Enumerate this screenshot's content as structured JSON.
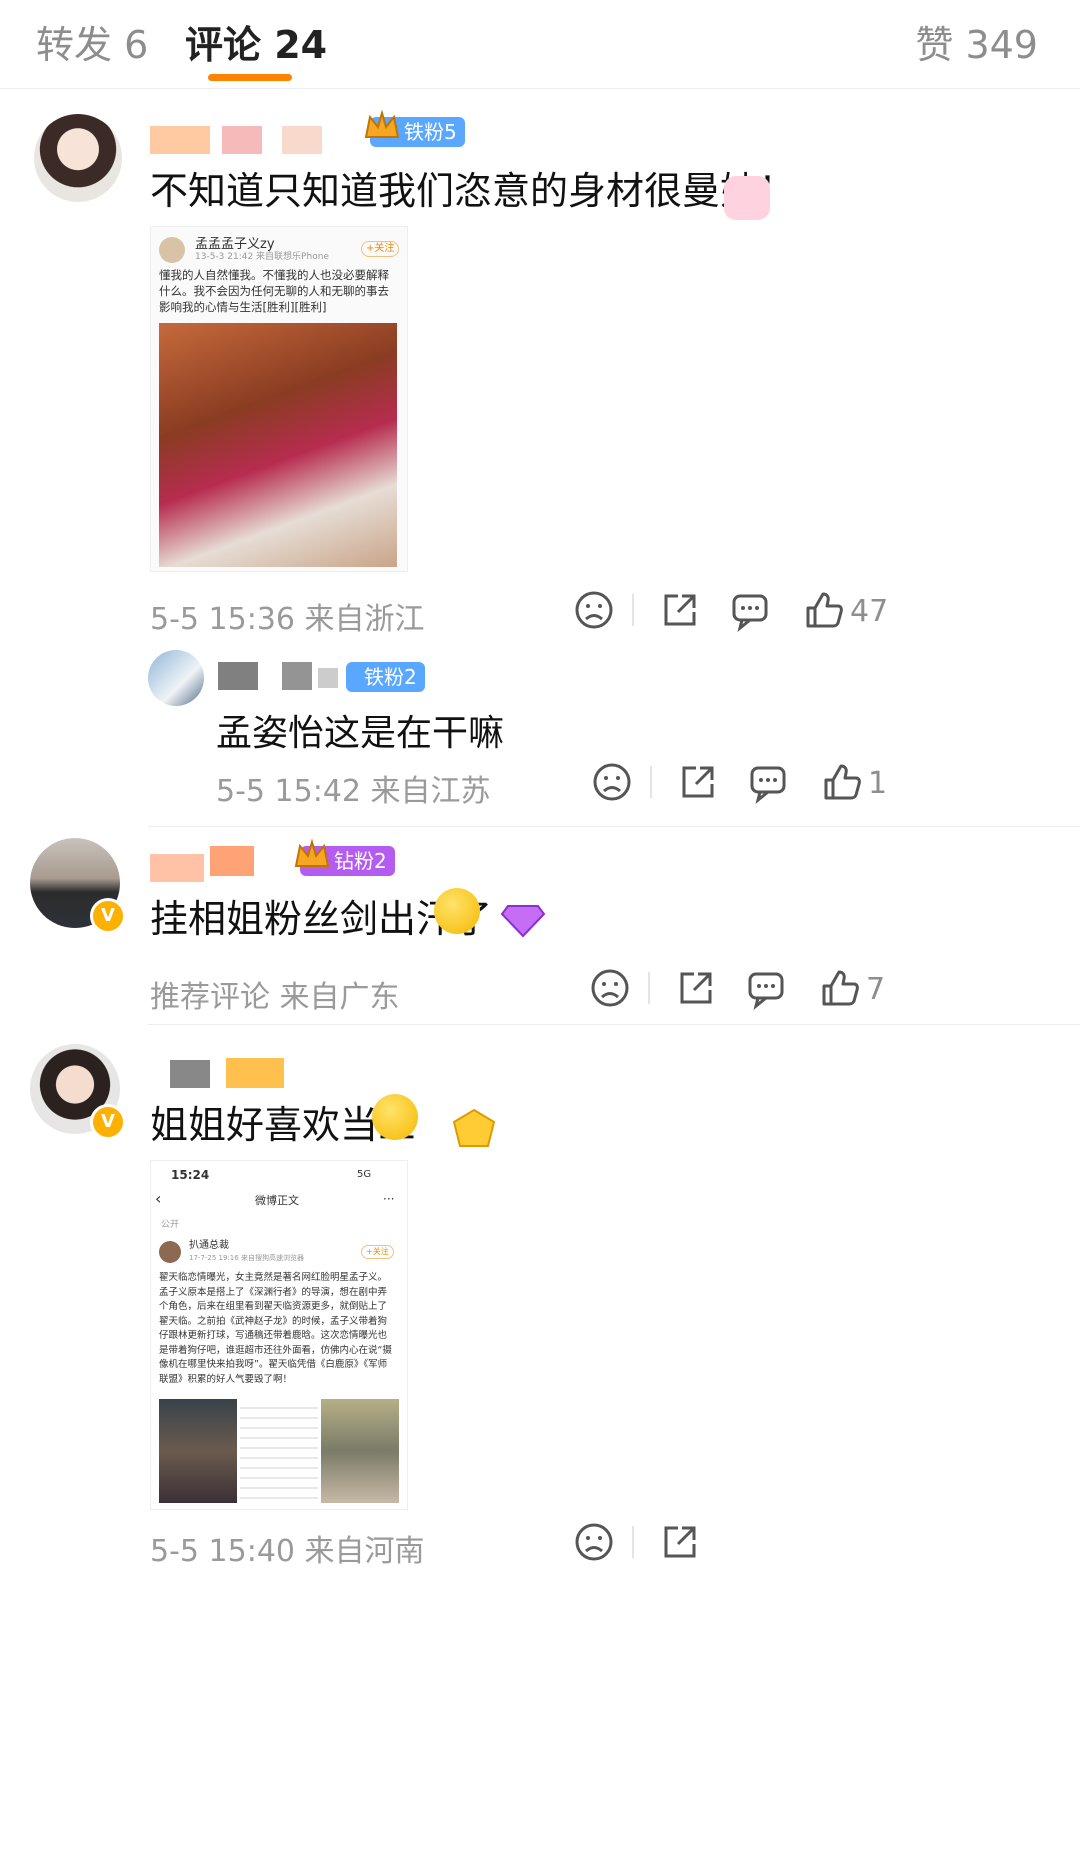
{
  "tabs": {
    "repost": "转发 6",
    "comments": "评论 24",
    "likes": "赞 349"
  },
  "comments": [
    {
      "badge": "铁粉5",
      "text": "不知道只知道我们恣意的身材很曼妙！",
      "image": {
        "account": "孟孟孟子义zy",
        "time": "13-5-3 21:42 来自联想乐Phone",
        "follow": "+关注",
        "body": "懂我的人自然懂我。不懂我的人也没必要解释什么。我不会因为任何无聊的人和无聊的事去影响我的心情与生活[胜利][胜利]"
      },
      "meta": "5-5 15:36 来自浙江",
      "likes": "47"
    },
    {
      "badge": "铁粉2",
      "text": "孟姿怡这是在干嘛",
      "meta": "5-5 15:42 来自江苏",
      "likes": "1"
    },
    {
      "badge": "钻粉2",
      "text": "挂相姐粉丝剑出汗了",
      "meta": "推荐评论 来自广东",
      "likes": "7"
    },
    {
      "text": "姐姐好喜欢当三",
      "image": {
        "status_time": "15:24",
        "status_icons": "5G",
        "nav_title": "微博正文",
        "visibility": "公开",
        "account": "扒通总裁",
        "time": "17-7-25 19:16 来自搜狗高速浏览器",
        "follow": "+关注",
        "body": "翟天临恋情曝光，女主竟然是著名网红脸明星孟子义。孟子义原本是搭上了《深渊行者》的导演，想在剧中弄个角色，后来在组里看到翟天临资源更多，就倒贴上了翟天临。之前拍《武神赵子龙》的时候，孟子义带着狗仔跟林更新打球，写通稿还带着鹿晗。这次恋情曝光也是带着狗仔吧，谁逛超市还往外面看，仿佛内心在说“摄像机在哪里快来拍我呀”。翟天临凭借《白鹿原》《军师联盟》积累的好人气要毁了啊！"
      },
      "meta": "5-5 15:40 来自河南"
    }
  ],
  "colors": {
    "accent": "#ff8200",
    "badge_iron": "#5aa7ff",
    "badge_diamond": "#b55cf0",
    "verified": "#ffb000"
  }
}
